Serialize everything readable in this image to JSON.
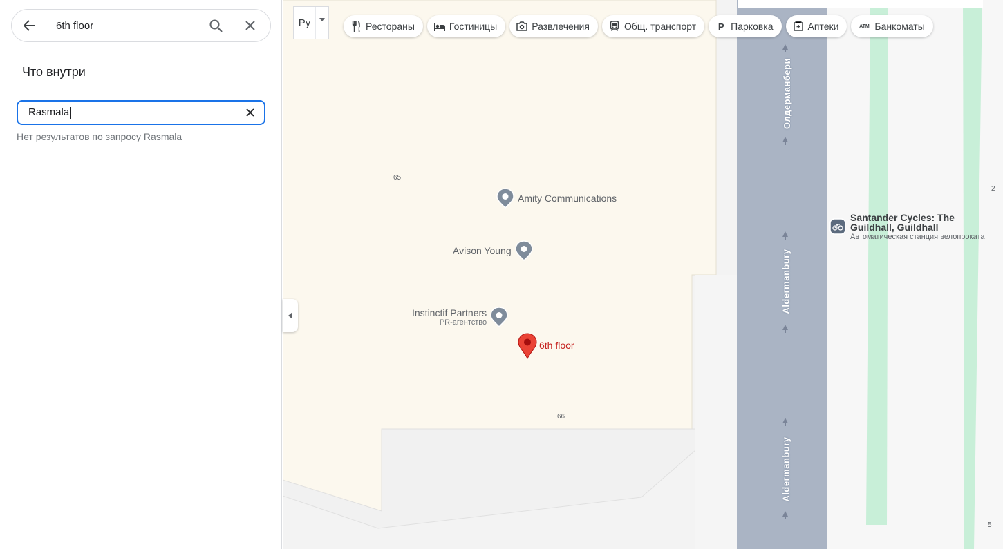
{
  "search": {
    "query": "6th floor"
  },
  "inside": {
    "title": "Что внутри",
    "value": "Rasmala",
    "no_results": "Нет результатов по запросу Rasmala"
  },
  "layer": {
    "label": "Pу"
  },
  "chips": [
    {
      "label": "Рестораны",
      "icon": "restaurant-icon"
    },
    {
      "label": "Гостиницы",
      "icon": "hotel-icon"
    },
    {
      "label": "Развлечения",
      "icon": "camera-icon"
    },
    {
      "label": "Общ. транспорт",
      "icon": "transit-icon"
    },
    {
      "label": "Парковка",
      "icon": "parking-icon"
    },
    {
      "label": "Аптеки",
      "icon": "pharmacy-icon"
    },
    {
      "label": "Банкоматы",
      "icon": "atm-icon"
    }
  ],
  "places": {
    "amity": "Amity Communications",
    "avison": "Avison Young",
    "instinctif": "Instinctif Partners",
    "instinctif_sub": "PR-агентство",
    "selected": "6th floor",
    "santander_name_1": "Santander Cycles: The",
    "santander_name_2": "Guildhall, Guildhall",
    "santander_sub": "Автоматическая станция велопроката"
  },
  "streets": {
    "ru": "Олдерманбери",
    "en1": "Aldermanbury",
    "en2": "Aldermanbury"
  },
  "numbers": {
    "n65": "65",
    "n66": "66",
    "n2": "2",
    "n5": "5"
  },
  "icons": {
    "atm_text": "ATM"
  },
  "colors": {
    "accent": "#1a73e8",
    "pin": "#ea4335",
    "road": "#aab4c4",
    "building": "#fcf8ee",
    "park": "#c8efd8"
  }
}
